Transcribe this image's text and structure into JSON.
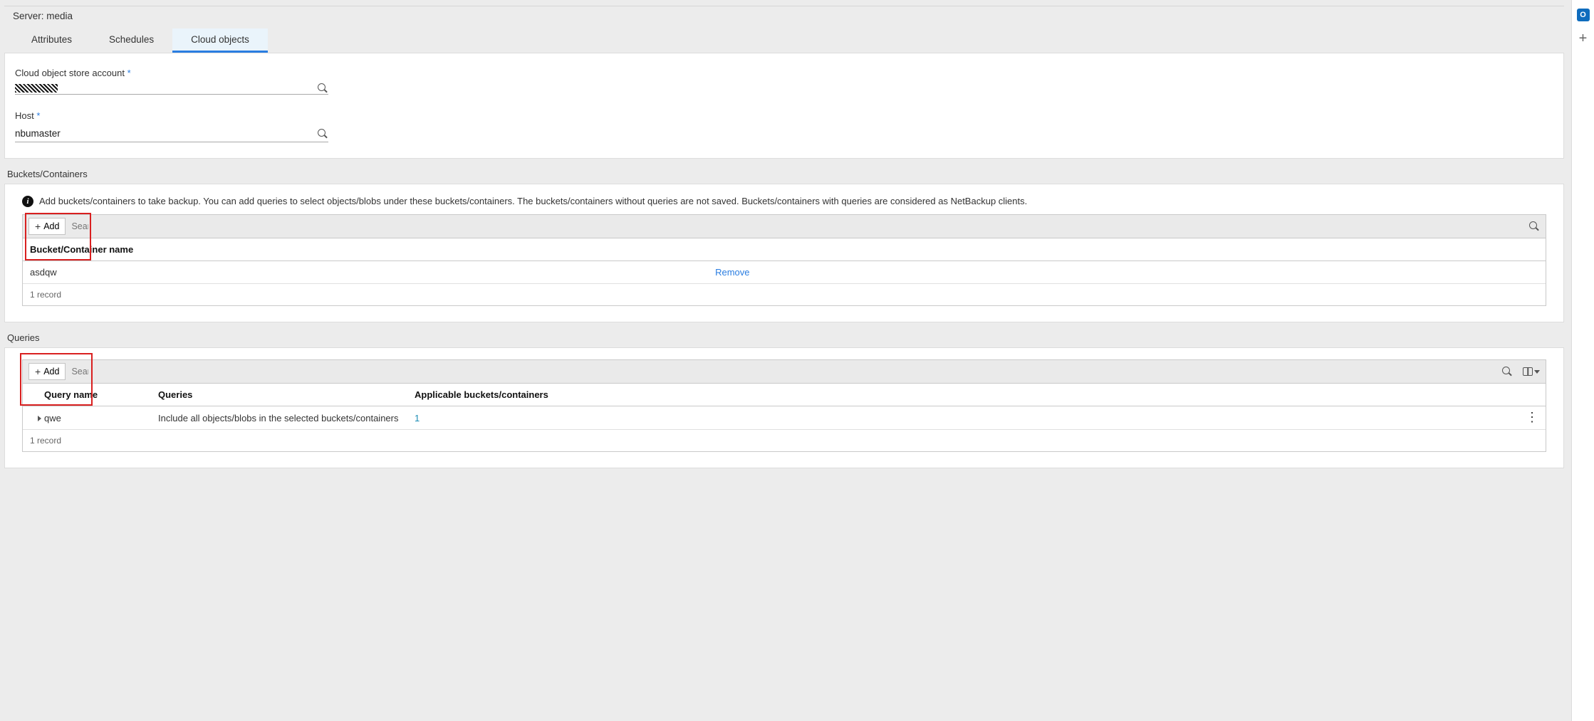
{
  "header": {
    "server_prefix": "Server:",
    "server_name": "media"
  },
  "tabs": {
    "attributes": "Attributes",
    "schedules": "Schedules",
    "cloud_objects": "Cloud objects"
  },
  "form": {
    "account_label": "Cloud object store account",
    "host_label": "Host",
    "host_value": "nbumaster",
    "required_marker": "*"
  },
  "buckets": {
    "section_title": "Buckets/Containers",
    "info_text": "Add buckets/containers to take backup. You can add queries to select objects/blobs under these buckets/containers. The buckets/containers without queries are not saved. Buckets/containers with queries are considered as NetBackup clients.",
    "add_label": "Add",
    "search_placeholder": "Search...",
    "header_name": "Bucket/Container name",
    "rows": [
      {
        "name": "asdqw",
        "action": "Remove"
      }
    ],
    "footer": "1 record"
  },
  "queries": {
    "section_title": "Queries",
    "add_label": "Add",
    "search_placeholder": "Search...",
    "header_name": "Query name",
    "header_queries": "Queries",
    "header_buckets": "Applicable buckets/containers",
    "rows": [
      {
        "name": "qwe",
        "queries": "Include all objects/blobs in the selected buckets/containers",
        "buckets_count": "1"
      }
    ],
    "footer": "1 record"
  }
}
